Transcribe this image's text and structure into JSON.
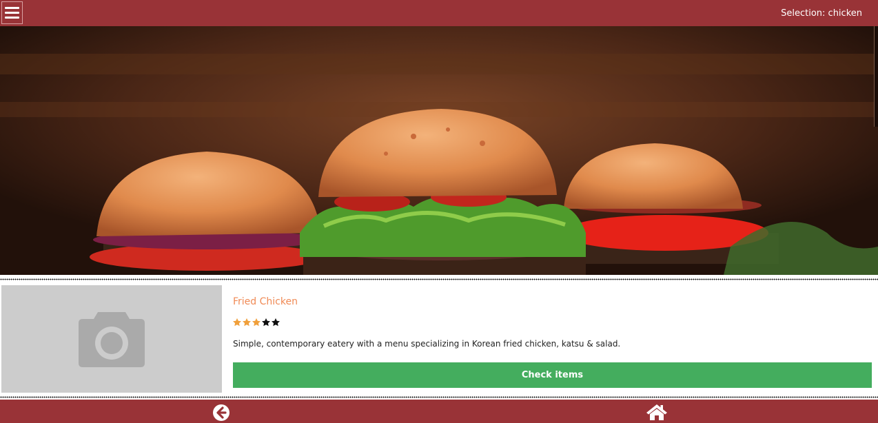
{
  "header": {
    "menu_icon": "hamburger-menu-icon",
    "selection_text": "Selection: chicken",
    "background_color": "#993337"
  },
  "hero": {
    "image_subject": "burgers photo"
  },
  "restaurant": {
    "photo_icon": "camera-icon",
    "name": "Fried Chicken",
    "rating": 3,
    "rating_max": 5,
    "description": "Simple, contemporary eatery with a menu specializing in Korean fried chicken, katsu & salad.",
    "button_label": "Check items",
    "name_color": "#f08a55",
    "button_color": "#44ad5e"
  },
  "footer": {
    "back_icon": "back-arrow-icon",
    "home_icon": "home-icon"
  }
}
